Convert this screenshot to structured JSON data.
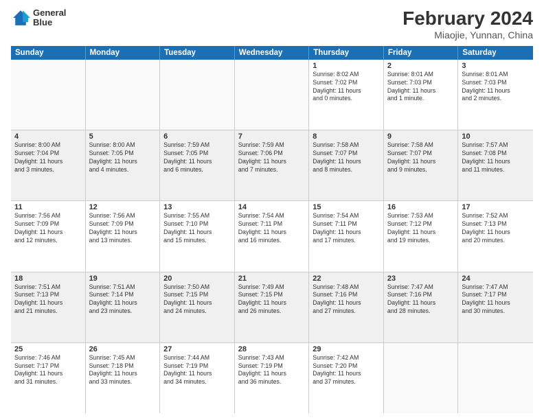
{
  "header": {
    "logo_line1": "General",
    "logo_line2": "Blue",
    "main_title": "February 2024",
    "subtitle": "Miaojie, Yunnan, China"
  },
  "calendar": {
    "day_headers": [
      "Sunday",
      "Monday",
      "Tuesday",
      "Wednesday",
      "Thursday",
      "Friday",
      "Saturday"
    ],
    "weeks": [
      [
        {
          "day": "",
          "info": "",
          "empty": true
        },
        {
          "day": "",
          "info": "",
          "empty": true
        },
        {
          "day": "",
          "info": "",
          "empty": true
        },
        {
          "day": "",
          "info": "",
          "empty": true
        },
        {
          "day": "1",
          "info": "Sunrise: 8:02 AM\nSunset: 7:02 PM\nDaylight: 11 hours\nand 0 minutes."
        },
        {
          "day": "2",
          "info": "Sunrise: 8:01 AM\nSunset: 7:03 PM\nDaylight: 11 hours\nand 1 minute."
        },
        {
          "day": "3",
          "info": "Sunrise: 8:01 AM\nSunset: 7:03 PM\nDaylight: 11 hours\nand 2 minutes."
        }
      ],
      [
        {
          "day": "4",
          "info": "Sunrise: 8:00 AM\nSunset: 7:04 PM\nDaylight: 11 hours\nand 3 minutes.",
          "shaded": true
        },
        {
          "day": "5",
          "info": "Sunrise: 8:00 AM\nSunset: 7:05 PM\nDaylight: 11 hours\nand 4 minutes.",
          "shaded": true
        },
        {
          "day": "6",
          "info": "Sunrise: 7:59 AM\nSunset: 7:05 PM\nDaylight: 11 hours\nand 6 minutes.",
          "shaded": true
        },
        {
          "day": "7",
          "info": "Sunrise: 7:59 AM\nSunset: 7:06 PM\nDaylight: 11 hours\nand 7 minutes.",
          "shaded": true
        },
        {
          "day": "8",
          "info": "Sunrise: 7:58 AM\nSunset: 7:07 PM\nDaylight: 11 hours\nand 8 minutes.",
          "shaded": true
        },
        {
          "day": "9",
          "info": "Sunrise: 7:58 AM\nSunset: 7:07 PM\nDaylight: 11 hours\nand 9 minutes.",
          "shaded": true
        },
        {
          "day": "10",
          "info": "Sunrise: 7:57 AM\nSunset: 7:08 PM\nDaylight: 11 hours\nand 11 minutes.",
          "shaded": true
        }
      ],
      [
        {
          "day": "11",
          "info": "Sunrise: 7:56 AM\nSunset: 7:09 PM\nDaylight: 11 hours\nand 12 minutes."
        },
        {
          "day": "12",
          "info": "Sunrise: 7:56 AM\nSunset: 7:09 PM\nDaylight: 11 hours\nand 13 minutes."
        },
        {
          "day": "13",
          "info": "Sunrise: 7:55 AM\nSunset: 7:10 PM\nDaylight: 11 hours\nand 15 minutes."
        },
        {
          "day": "14",
          "info": "Sunrise: 7:54 AM\nSunset: 7:11 PM\nDaylight: 11 hours\nand 16 minutes."
        },
        {
          "day": "15",
          "info": "Sunrise: 7:54 AM\nSunset: 7:11 PM\nDaylight: 11 hours\nand 17 minutes."
        },
        {
          "day": "16",
          "info": "Sunrise: 7:53 AM\nSunset: 7:12 PM\nDaylight: 11 hours\nand 19 minutes."
        },
        {
          "day": "17",
          "info": "Sunrise: 7:52 AM\nSunset: 7:13 PM\nDaylight: 11 hours\nand 20 minutes."
        }
      ],
      [
        {
          "day": "18",
          "info": "Sunrise: 7:51 AM\nSunset: 7:13 PM\nDaylight: 11 hours\nand 21 minutes.",
          "shaded": true
        },
        {
          "day": "19",
          "info": "Sunrise: 7:51 AM\nSunset: 7:14 PM\nDaylight: 11 hours\nand 23 minutes.",
          "shaded": true
        },
        {
          "day": "20",
          "info": "Sunrise: 7:50 AM\nSunset: 7:15 PM\nDaylight: 11 hours\nand 24 minutes.",
          "shaded": true
        },
        {
          "day": "21",
          "info": "Sunrise: 7:49 AM\nSunset: 7:15 PM\nDaylight: 11 hours\nand 26 minutes.",
          "shaded": true
        },
        {
          "day": "22",
          "info": "Sunrise: 7:48 AM\nSunset: 7:16 PM\nDaylight: 11 hours\nand 27 minutes.",
          "shaded": true
        },
        {
          "day": "23",
          "info": "Sunrise: 7:47 AM\nSunset: 7:16 PM\nDaylight: 11 hours\nand 28 minutes.",
          "shaded": true
        },
        {
          "day": "24",
          "info": "Sunrise: 7:47 AM\nSunset: 7:17 PM\nDaylight: 11 hours\nand 30 minutes.",
          "shaded": true
        }
      ],
      [
        {
          "day": "25",
          "info": "Sunrise: 7:46 AM\nSunset: 7:17 PM\nDaylight: 11 hours\nand 31 minutes."
        },
        {
          "day": "26",
          "info": "Sunrise: 7:45 AM\nSunset: 7:18 PM\nDaylight: 11 hours\nand 33 minutes."
        },
        {
          "day": "27",
          "info": "Sunrise: 7:44 AM\nSunset: 7:19 PM\nDaylight: 11 hours\nand 34 minutes."
        },
        {
          "day": "28",
          "info": "Sunrise: 7:43 AM\nSunset: 7:19 PM\nDaylight: 11 hours\nand 36 minutes."
        },
        {
          "day": "29",
          "info": "Sunrise: 7:42 AM\nSunset: 7:20 PM\nDaylight: 11 hours\nand 37 minutes."
        },
        {
          "day": "",
          "info": "",
          "empty": true
        },
        {
          "day": "",
          "info": "",
          "empty": true
        }
      ]
    ]
  }
}
